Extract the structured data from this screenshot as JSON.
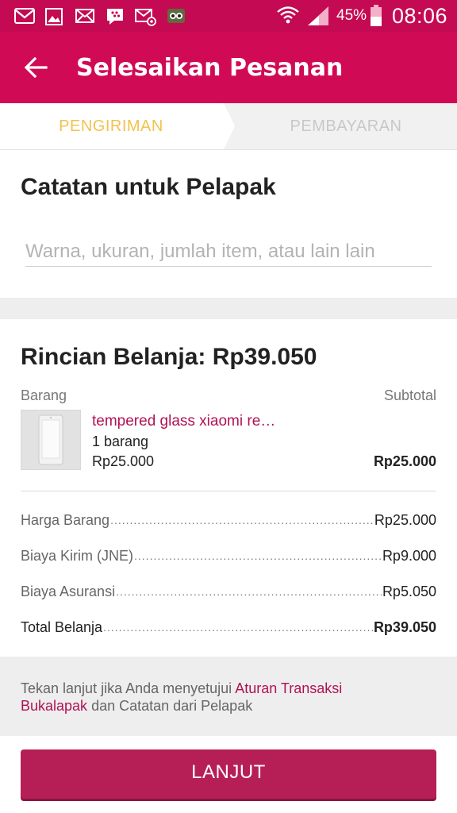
{
  "status_bar": {
    "battery_percent": "45%",
    "time": "08:06",
    "icons": [
      "gmail-icon",
      "gallery-icon",
      "email-icon",
      "bbm-icon",
      "email-at-icon",
      "owl-app-icon",
      "wifi-icon",
      "signal-icon",
      "battery-icon"
    ]
  },
  "app_bar": {
    "title": "Selesaikan Pesanan"
  },
  "steps": {
    "step1": "PENGIRIMAN",
    "step2": "PEMBAYARAN",
    "active_color": "#f2c24f",
    "inactive_color": "#c8c8c8"
  },
  "notes": {
    "title": "Catatan untuk Pelapak",
    "placeholder": "Warna, ukuran, jumlah item, atau lain lain",
    "value": ""
  },
  "details": {
    "title": "Rincian Belanja: Rp39.050",
    "col_item": "Barang",
    "col_subtotal": "Subtotal",
    "product": {
      "name": "tempered glass xiaomi re…",
      "qty": "1 barang",
      "price": "Rp25.000",
      "subtotal": "Rp25.000"
    },
    "rows": [
      {
        "label": "Harga Barang",
        "value": "Rp25.000"
      },
      {
        "label": "Biaya Kirim (JNE)",
        "value": "Rp9.000"
      },
      {
        "label": "Biaya Asuransi",
        "value": "Rp5.050"
      },
      {
        "label": "Total Belanja",
        "value": "Rp39.050"
      }
    ]
  },
  "agreement": {
    "prefix": "Tekan lanjut jika Anda menyetujui ",
    "link1": "Aturan Transaksi",
    "link2": "Bukalapak",
    "suffix": " dan Catatan dari Pelapak"
  },
  "button": {
    "label": "LANJUT"
  },
  "colors": {
    "brand": "#d10a55",
    "status_bar": "#c40a52",
    "button": "#b61f56",
    "link": "#b01255"
  }
}
